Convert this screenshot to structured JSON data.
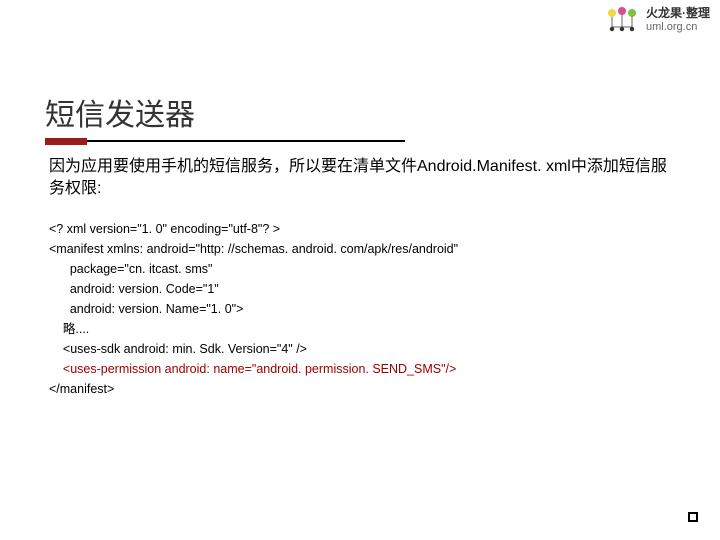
{
  "branding": {
    "line1": "火龙果·整理",
    "line2": "uml.org.cn",
    "icon_name": "dragonfruit-logo-icon"
  },
  "title": "短信发送器",
  "description": "因为应用要使用手机的短信服务，所以要在清单文件Android.Manifest. xml中添加短信服务权限:",
  "code": {
    "lines": [
      "<? xml version=\"1. 0\" encoding=\"utf-8\"? >",
      "<manifest xmlns: android=\"http: //schemas. android. com/apk/res/android\"",
      "      package=\"cn. itcast. sms\"",
      "      android: version. Code=\"1\"",
      "      android: version. Name=\"1. 0\">",
      "    略....",
      "    <uses-sdk android: min. Sdk. Version=\"4\" />",
      "    <uses-permission android: name=\"android. permission. SEND_SMS\"/>",
      "</manifest>"
    ],
    "highlight_index": 7
  }
}
